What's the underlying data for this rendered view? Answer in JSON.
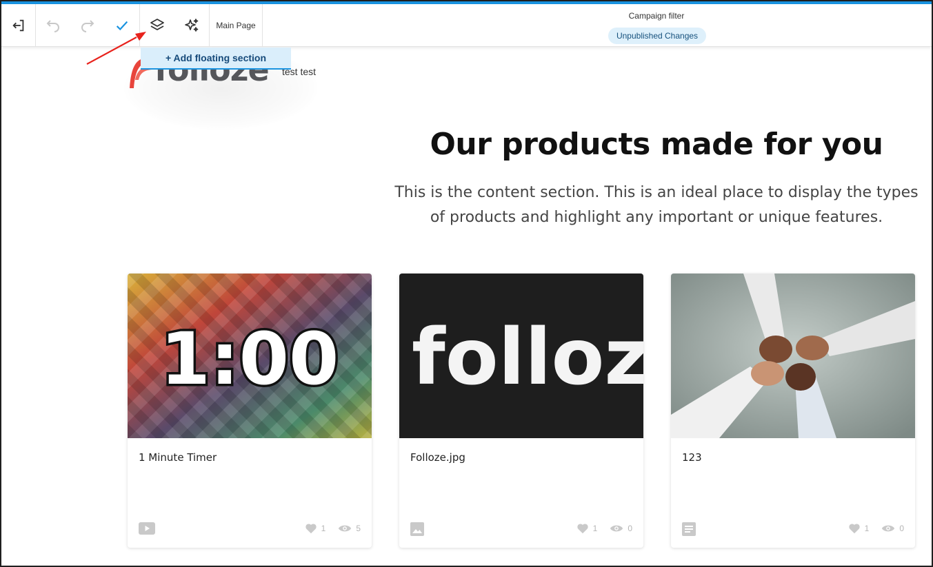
{
  "toolbar": {
    "main_page_label": "Main Page",
    "campaign_filter_label": "Campaign filter",
    "unpublished_badge": "Unpublished Changes",
    "add_floating_section": "+ Add floating section",
    "icons": [
      "exit-icon",
      "undo-icon",
      "redo-icon",
      "check-icon",
      "layers-icon",
      "sparkles-icon"
    ]
  },
  "header": {
    "logo_text": "folloze",
    "test_text": "test test"
  },
  "content": {
    "headline": "Our products made for you",
    "subtext_line1": "This is the content section. This is an ideal place to display the types",
    "subtext_line2": "of products and highlight any important or unique features."
  },
  "cards": [
    {
      "title": "1 Minute Timer",
      "image_text": "1:00",
      "type_icon": "video-icon",
      "likes": "1",
      "views": "5"
    },
    {
      "title": "Folloze.jpg",
      "image_text": "folloz",
      "type_icon": "image-icon",
      "likes": "1",
      "views": "0"
    },
    {
      "title": "123",
      "image_text": "",
      "type_icon": "document-icon",
      "likes": "1",
      "views": "0"
    }
  ],
  "colors": {
    "accent": "#1a93e0",
    "badge_bg": "#def0fb",
    "annotation_arrow": "#e8221c"
  }
}
